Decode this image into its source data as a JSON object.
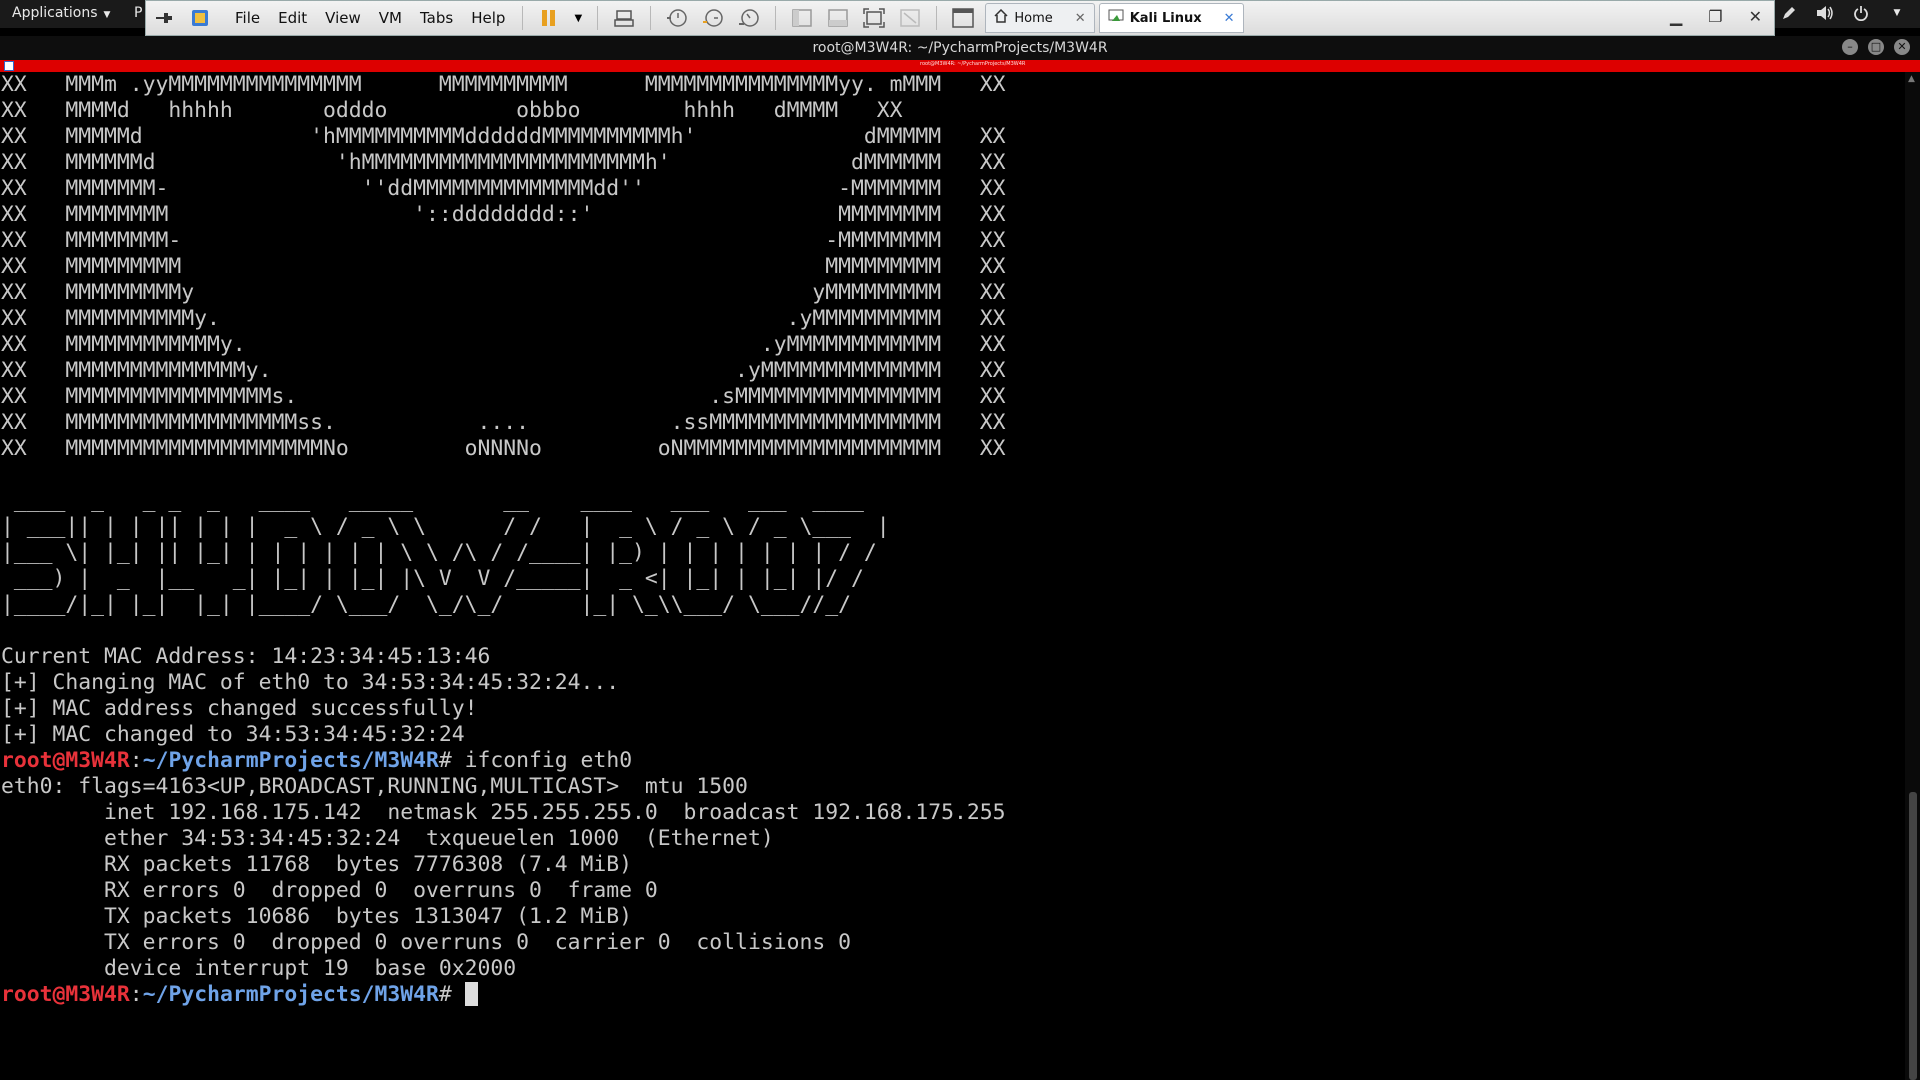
{
  "kali_panel": {
    "applications_label": "Applications",
    "places_label": "P",
    "tray_icons": [
      "pen-icon",
      "volume-icon",
      "power-icon"
    ]
  },
  "vmware": {
    "menu": [
      "File",
      "Edit",
      "View",
      "VM",
      "Tabs",
      "Help"
    ],
    "tabs": [
      {
        "label": "Home",
        "active": false
      },
      {
        "label": "Kali Linux",
        "active": true
      }
    ]
  },
  "terminal_title": "root@M3W4R: ~/PycharmProjects/M3W4R",
  "terminal": {
    "ascii_logo": [
      "XX   MMMm .yyMMMMMMMMMMMMMMM      MMMMMMMMMM      MMMMMMMMMMMMMMMyy. mMMM   XX",
      "XX   MMMMd   hhhhh       odddo          obbbo        hhhh   dMMMM   XX",
      "XX   MMMMMd             'hMMMMMMMMMMddddddMMMMMMMMMMh'             dMMMMM   XX",
      "XX   MMMMMMd              'hMMMMMMMMMMMMMMMMMMMMMMh'              dMMMMMM   XX",
      "XX   MMMMMMM-               ''ddMMMMMMMMMMMMMMdd''               -MMMMMMM   XX",
      "XX   MMMMMMMM                   '::dddddddd::'                   MMMMMMMM   XX",
      "XX   MMMMMMMM-                                                  -MMMMMMMM   XX",
      "XX   MMMMMMMMM                                                  MMMMMMMMM   XX",
      "XX   MMMMMMMMMy                                                yMMMMMMMMM   XX",
      "XX   MMMMMMMMMMy.                                            .yMMMMMMMMMM   XX",
      "XX   MMMMMMMMMMMMy.                                        .yMMMMMMMMMMMM   XX",
      "XX   MMMMMMMMMMMMMMy.                                    .yMMMMMMMMMMMMMM   XX",
      "XX   MMMMMMMMMMMMMMMMs.                                .sMMMMMMMMMMMMMMMM   XX",
      "XX   MMMMMMMMMMMMMMMMMMss.           ....           .ssMMMMMMMMMMMMMMMMMM   XX",
      "XX   MMMMMMMMMMMMMMMMMMMMNo         oNNNNo         oNMMMMMMMMMMMMMMMMMMMM   XX"
    ],
    "ascii_banner": [
      "",
      " ____  _   _ _  _   ____   _____       __    ____   ___   ___  ____",
      "| ___|| | | || | | |  _ \\ / _ \\ \\      / /   |  _ \\ / _ \\ / _ \\___  |",
      "|___ \\| |_| || |_| | | | | | | \\ \\ /\\ / /____| |_) | | | | | | | / /",
      " ___) |  _  |__   _| |_| | |_| |\\ V  V /_____|  _ <| |_| | |_| |/ /",
      "|____/|_| |_|  |_| |____/ \\___/  \\_/\\_/      |_| \\_\\\\___/ \\___//_/",
      "",
      ""
    ],
    "output_lines": [
      "Current MAC Address: 14:23:34:45:13:46",
      "[+] Changing MAC of eth0 to 34:53:34:45:32:24...",
      "[+] MAC address changed successfully!",
      "[+] MAC changed to 34:53:34:45:32:24"
    ],
    "prompt_user": "root@M3W4R",
    "prompt_sep": ":",
    "prompt_path": "~/PycharmProjects/M3W4R",
    "prompt_end": "# ",
    "command": "ifconfig eth0",
    "ifconfig_lines": [
      "eth0: flags=4163<UP,BROADCAST,RUNNING,MULTICAST>  mtu 1500",
      "        inet 192.168.175.142  netmask 255.255.255.0  broadcast 192.168.175.255",
      "        ether 34:53:34:45:32:24  txqueuelen 1000  (Ethernet)",
      "        RX packets 11768  bytes 7776308 (7.4 MiB)",
      "        RX errors 0  dropped 0  overruns 0  frame 0",
      "        TX packets 10686  bytes 1313047 (1.2 MiB)",
      "        TX errors 0  dropped 0 overruns 0  carrier 0  collisions 0",
      "        device interrupt 19  base 0x2000",
      ""
    ]
  },
  "colors": {
    "prompt_user": "#e8323a",
    "prompt_path": "#6fa3e8",
    "red_bar": "#dd0000"
  }
}
